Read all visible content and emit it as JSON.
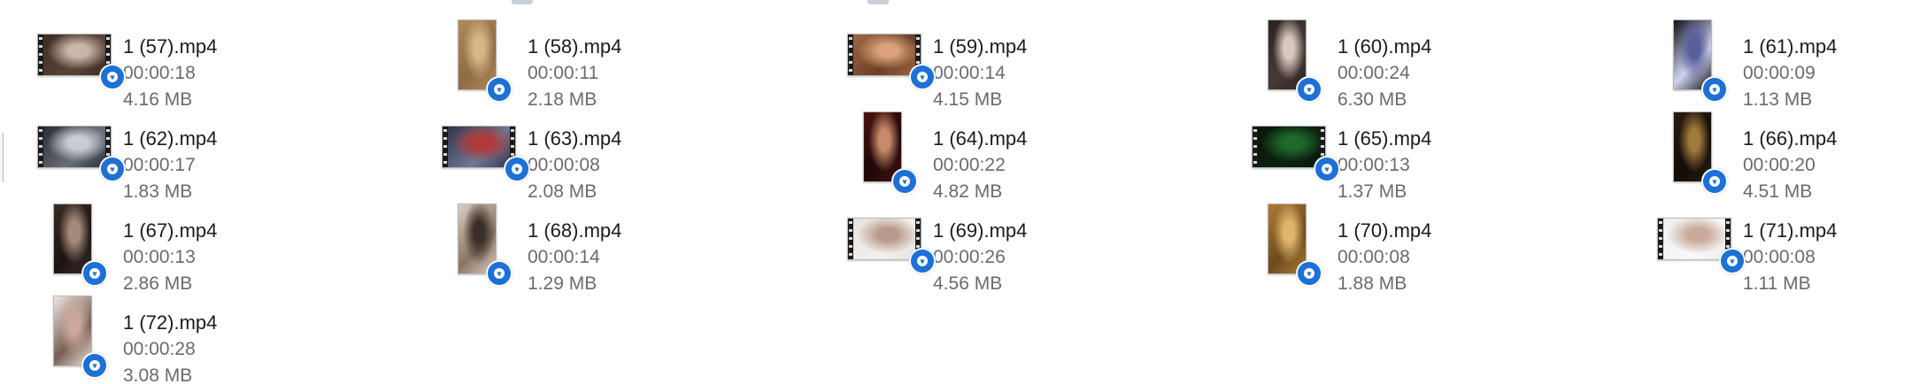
{
  "window": {
    "view_mode": "Tiles"
  },
  "files": [
    {
      "name": "1 (57).mp4",
      "duration": "00:00:18",
      "size": "4.16 MB",
      "thumbnail": {
        "orientation": "landscape",
        "film_strip": true,
        "colors": [
          "#3b2a22",
          "#c9b7a8",
          "#5a4438"
        ]
      },
      "badge_icon": "video-player-icon"
    },
    {
      "name": "1 (58).mp4",
      "duration": "00:00:11",
      "size": "2.18 MB",
      "thumbnail": {
        "orientation": "portrait",
        "film_strip": false,
        "colors": [
          "#b38b5a",
          "#d7b78a",
          "#8d6a42"
        ]
      },
      "badge_icon": "video-player-icon"
    },
    {
      "name": "1 (59).mp4",
      "duration": "00:00:14",
      "size": "4.15 MB",
      "thumbnail": {
        "orientation": "landscape",
        "film_strip": true,
        "colors": [
          "#a56b45",
          "#d9a27a",
          "#6b3f26"
        ]
      },
      "badge_icon": "video-player-icon"
    },
    {
      "name": "1 (60).mp4",
      "duration": "00:00:24",
      "size": "6.30 MB",
      "thumbnail": {
        "orientation": "portrait",
        "film_strip": false,
        "colors": [
          "#2a2220",
          "#d8c8c0",
          "#4a3a36"
        ]
      },
      "badge_icon": "video-player-icon"
    },
    {
      "name": "1 (61).mp4",
      "duration": "00:00:09",
      "size": "1.13 MB",
      "thumbnail": {
        "orientation": "portrait",
        "film_strip": false,
        "colors": [
          "#101018",
          "#5a5f9c",
          "#cfd3f0"
        ]
      },
      "badge_icon": "video-player-icon"
    },
    {
      "name": "1 (62).mp4",
      "duration": "00:00:17",
      "size": "1.83 MB",
      "thumbnail": {
        "orientation": "landscape",
        "film_strip": true,
        "colors": [
          "#1f2733",
          "#c9ccd2",
          "#6a6e76"
        ]
      },
      "badge_icon": "video-player-icon"
    },
    {
      "name": "1 (63).mp4",
      "duration": "00:00:08",
      "size": "2.08 MB",
      "thumbnail": {
        "orientation": "landscape",
        "film_strip": true,
        "colors": [
          "#2a2f44",
          "#b03a3a",
          "#6f7896"
        ]
      },
      "badge_icon": "video-player-icon"
    },
    {
      "name": "1 (64).mp4",
      "duration": "00:00:22",
      "size": "4.82 MB",
      "thumbnail": {
        "orientation": "portrait",
        "film_strip": false,
        "colors": [
          "#4a1010",
          "#c98a6a",
          "#1c0808"
        ]
      },
      "badge_icon": "video-player-icon"
    },
    {
      "name": "1 (65).mp4",
      "duration": "00:00:13",
      "size": "1.37 MB",
      "thumbnail": {
        "orientation": "landscape",
        "film_strip": true,
        "colors": [
          "#07140a",
          "#1e6a2a",
          "#0c2410"
        ]
      },
      "badge_icon": "video-player-icon"
    },
    {
      "name": "1 (66).mp4",
      "duration": "00:00:20",
      "size": "4.51 MB",
      "thumbnail": {
        "orientation": "portrait",
        "film_strip": false,
        "colors": [
          "#2a1c10",
          "#a07a3a",
          "#120c06"
        ]
      },
      "badge_icon": "video-player-icon"
    },
    {
      "name": "1 (67).mp4",
      "duration": "00:00:13",
      "size": "2.86 MB",
      "thumbnail": {
        "orientation": "portrait",
        "film_strip": false,
        "colors": [
          "#3a2a24",
          "#a58a7c",
          "#1c1412"
        ]
      },
      "badge_icon": "video-player-icon"
    },
    {
      "name": "1 (68).mp4",
      "duration": "00:00:14",
      "size": "1.29 MB",
      "thumbnail": {
        "orientation": "portrait",
        "film_strip": false,
        "colors": [
          "#d9cfc4",
          "#3a2e28",
          "#8a7464"
        ]
      },
      "badge_icon": "video-player-icon"
    },
    {
      "name": "1 (69).mp4",
      "duration": "00:00:26",
      "size": "4.56 MB",
      "thumbnail": {
        "orientation": "landscape",
        "film_strip": true,
        "colors": [
          "#e6e2de",
          "#b89a8a",
          "#f3f0ee"
        ]
      },
      "badge_icon": "video-player-icon"
    },
    {
      "name": "1 (70).mp4",
      "duration": "00:00:08",
      "size": "1.88 MB",
      "thumbnail": {
        "orientation": "portrait",
        "film_strip": false,
        "colors": [
          "#b07a36",
          "#e0b46a",
          "#6a4a1e"
        ]
      },
      "badge_icon": "video-player-icon"
    },
    {
      "name": "1 (71).mp4",
      "duration": "00:00:08",
      "size": "1.11 MB",
      "thumbnail": {
        "orientation": "landscape",
        "film_strip": true,
        "colors": [
          "#eeeeee",
          "#c8aa98",
          "#f8f8f8"
        ]
      },
      "badge_icon": "video-player-icon"
    },
    {
      "name": "1 (72).mp4",
      "duration": "00:00:28",
      "size": "3.08 MB",
      "thumbnail": {
        "orientation": "portrait",
        "film_strip": false,
        "colors": [
          "#ece7e2",
          "#c9a89a",
          "#7a5f52"
        ]
      },
      "badge_icon": "video-player-icon"
    }
  ]
}
